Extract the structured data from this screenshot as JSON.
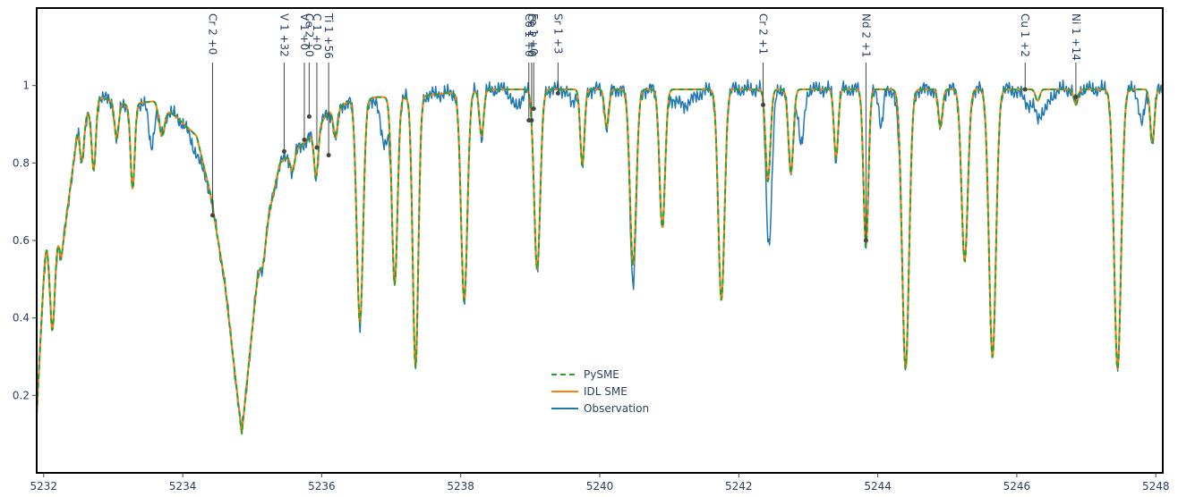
{
  "chart_data": {
    "type": "line",
    "xlim": [
      5231.9,
      5248.1
    ],
    "ylim": [
      0.0,
      1.2
    ],
    "x_ticks": [
      5232,
      5234,
      5236,
      5238,
      5240,
      5242,
      5244,
      5246,
      5248
    ],
    "y_ticks": [
      0.2,
      0.4,
      0.6,
      0.8,
      1
    ],
    "x_tick_labels": [
      "5232",
      "5234",
      "5236",
      "5238",
      "5240",
      "5242",
      "5244",
      "5246",
      "5248"
    ],
    "y_tick_labels": [
      "0.2",
      "0.4",
      "0.6",
      "0.8",
      "1"
    ],
    "grid": false,
    "legend_position": "center-bottom",
    "continuum": [
      [
        5231.9,
        0.15
      ],
      [
        5232.1,
        0.86
      ],
      [
        5232.25,
        0.55
      ],
      [
        5232.5,
        0.9
      ],
      [
        5232.8,
        0.97
      ],
      [
        5233.2,
        0.95
      ],
      [
        5233.6,
        0.96
      ],
      [
        5233.9,
        0.92
      ],
      [
        5234.2,
        0.87
      ],
      [
        5234.4,
        0.72
      ],
      [
        5234.6,
        0.5
      ],
      [
        5234.85,
        0.1
      ],
      [
        5235.1,
        0.55
      ],
      [
        5235.4,
        0.8
      ],
      [
        5235.8,
        0.86
      ],
      [
        5236.1,
        0.93
      ],
      [
        5236.4,
        0.96
      ],
      [
        5236.8,
        0.97
      ],
      [
        5237.3,
        0.97
      ],
      [
        5237.8,
        0.98
      ],
      [
        5238.5,
        0.99
      ],
      [
        5239.0,
        0.99
      ],
      [
        5239.5,
        0.99
      ],
      [
        5240.0,
        0.99
      ],
      [
        5240.5,
        0.99
      ],
      [
        5241.0,
        0.99
      ],
      [
        5241.5,
        0.99
      ],
      [
        5242.0,
        0.99
      ],
      [
        5242.5,
        0.99
      ],
      [
        5243.0,
        0.99
      ],
      [
        5243.5,
        0.99
      ],
      [
        5244.0,
        0.99
      ],
      [
        5244.5,
        0.99
      ],
      [
        5245.0,
        0.99
      ],
      [
        5245.5,
        0.99
      ],
      [
        5246.0,
        0.99
      ],
      [
        5246.5,
        0.99
      ],
      [
        5247.0,
        0.99
      ],
      [
        5247.5,
        0.99
      ],
      [
        5248.1,
        0.99
      ]
    ],
    "absorption_lines": [
      [
        5232.12,
        0.55,
        0.045
      ],
      [
        5232.55,
        0.12,
        0.03
      ],
      [
        5232.72,
        0.18,
        0.03
      ],
      [
        5233.05,
        0.1,
        0.03
      ],
      [
        5233.28,
        0.23,
        0.03
      ],
      [
        5233.7,
        0.08,
        0.04
      ],
      [
        5235.15,
        0.1,
        0.04
      ],
      [
        5235.58,
        0.06,
        0.03
      ],
      [
        5235.92,
        0.14,
        0.03
      ],
      [
        5236.2,
        0.08,
        0.03
      ],
      [
        5236.55,
        0.6,
        0.045
      ],
      [
        5237.05,
        0.5,
        0.04
      ],
      [
        5237.35,
        0.72,
        0.04
      ],
      [
        5238.05,
        0.55,
        0.045
      ],
      [
        5238.3,
        0.12,
        0.03
      ],
      [
        5239.1,
        0.07,
        0.03
      ],
      [
        5239.1,
        0.43,
        0.045
      ],
      [
        5239.75,
        0.2,
        0.03
      ],
      [
        5240.1,
        0.1,
        0.03
      ],
      [
        5240.48,
        0.46,
        0.045
      ],
      [
        5240.9,
        0.36,
        0.04
      ],
      [
        5241.75,
        0.55,
        0.045
      ],
      [
        5242.42,
        0.24,
        0.035
      ],
      [
        5242.75,
        0.22,
        0.035
      ],
      [
        5243.4,
        0.18,
        0.03
      ],
      [
        5243.83,
        0.41,
        0.035
      ],
      [
        5244.4,
        0.73,
        0.05
      ],
      [
        5244.9,
        0.1,
        0.03
      ],
      [
        5245.25,
        0.45,
        0.045
      ],
      [
        5245.65,
        0.7,
        0.05
      ],
      [
        5246.3,
        0.03,
        0.03
      ],
      [
        5246.85,
        0.04,
        0.03
      ],
      [
        5247.45,
        0.73,
        0.05
      ],
      [
        5247.95,
        0.14,
        0.03
      ]
    ],
    "observation_extra": [
      [
        5233.55,
        0.12,
        0.04
      ],
      [
        5234.2,
        0.05,
        0.08
      ],
      [
        5236.9,
        0.12,
        0.06
      ],
      [
        5238.8,
        0.05,
        0.06
      ],
      [
        5239.6,
        0.04,
        0.04
      ],
      [
        5240.48,
        0.08,
        0.04
      ],
      [
        5241.2,
        0.04,
        0.15
      ],
      [
        5242.45,
        0.25,
        0.04
      ],
      [
        5242.9,
        0.15,
        0.04
      ],
      [
        5244.3,
        0.05,
        0.04
      ],
      [
        5244.05,
        0.1,
        0.03
      ],
      [
        5246.2,
        0.04,
        0.1
      ],
      [
        5246.4,
        0.05,
        0.08
      ],
      [
        5247.8,
        0.09,
        0.04
      ]
    ],
    "series": [
      {
        "name": "PySME",
        "color": "#2ca02c",
        "dash": "6,4",
        "width": 2
      },
      {
        "name": "IDL SME",
        "color": "#ff7f0e",
        "dash": "",
        "width": 2
      },
      {
        "name": "Observation",
        "color": "#1f77b4",
        "dash": "",
        "width": 1.5
      }
    ],
    "line_markers": [
      {
        "label": "Cr 2 +0",
        "x": 5234.43,
        "y": 0.665
      },
      {
        "label": "V 1 +32",
        "x": 5235.46,
        "y": 0.83
      },
      {
        "label": "V 1 +0",
        "x": 5235.75,
        "y": 0.86
      },
      {
        "label": "Ce 2 +0",
        "x": 5235.82,
        "y": 0.92
      },
      {
        "label": "C 1 +0",
        "x": 5235.93,
        "y": 0.84
      },
      {
        "label": "Ti 1 +56",
        "x": 5236.1,
        "y": 0.82
      },
      {
        "label": "Co 1 +0",
        "x": 5238.98,
        "y": 0.91
      },
      {
        "label": "Ce 2 +0",
        "x": 5239.02,
        "y": 0.91
      },
      {
        "label": "Fe 1 +0",
        "x": 5239.05,
        "y": 0.94
      },
      {
        "label": "Sr 1 +3",
        "x": 5239.4,
        "y": 0.98
      },
      {
        "label": "Cr 2 +1",
        "x": 5242.35,
        "y": 0.95
      },
      {
        "label": "Nd 2 +1",
        "x": 5243.83,
        "y": 0.6
      },
      {
        "label": "Cu 1 +2",
        "x": 5246.12,
        "y": 0.99
      },
      {
        "label": "Ni 1 +14",
        "x": 5246.85,
        "y": 0.97
      }
    ]
  },
  "legend": {
    "entries": [
      "PySME",
      "IDL SME",
      "Observation"
    ]
  }
}
